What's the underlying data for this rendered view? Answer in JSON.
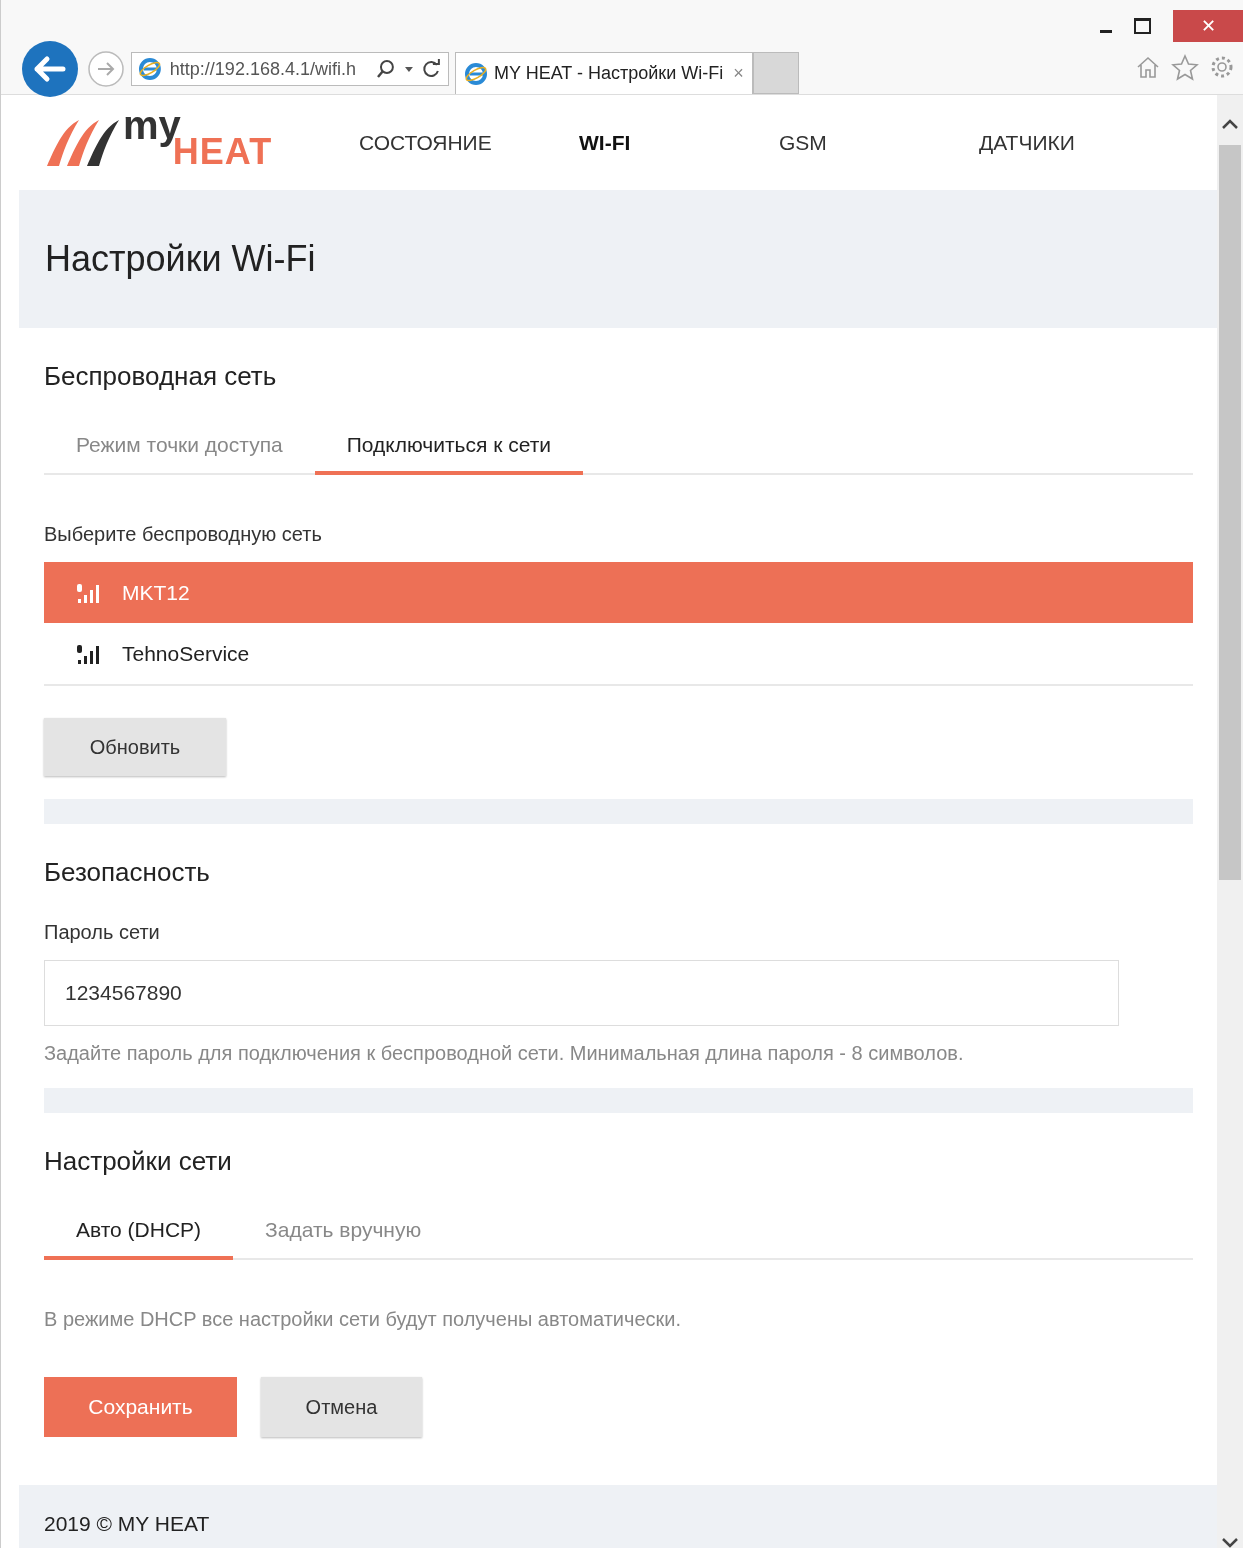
{
  "browser": {
    "address": "http://192.168.4.1/wifi.h",
    "tab_title": "MY HEAT - Настройки Wi-Fi",
    "tab_close": "×",
    "window_close": "✕"
  },
  "logo": {
    "top": "my",
    "bottom": "HEAT"
  },
  "nav": [
    {
      "label": "СОСТОЯНИЕ",
      "selected": false
    },
    {
      "label": "WI-FI",
      "selected": true
    },
    {
      "label": "GSM",
      "selected": false
    },
    {
      "label": "ДАТЧИКИ",
      "selected": false
    }
  ],
  "page_title": "Настройки Wi-Fi",
  "wireless": {
    "title": "Беспроводная сеть",
    "tabs": [
      {
        "label": "Режим точки доступа",
        "selected": false
      },
      {
        "label": "Подключиться к сети",
        "selected": true
      }
    ],
    "list_label": "Выберите беспроводную сеть",
    "networks": [
      {
        "name": "MKT12",
        "selected": true
      },
      {
        "name": "TehnoService",
        "selected": false
      }
    ],
    "refresh_button": "Обновить"
  },
  "security": {
    "title": "Безопасность",
    "field_label": "Пароль сети",
    "password": "1234567890",
    "hint": "Задайте пароль для подключения к беспроводной сети. Минимальная длина пароля - 8 символов."
  },
  "network_settings": {
    "title": "Настройки сети",
    "tabs": [
      {
        "label": "Авто (DHCP)",
        "selected": true
      },
      {
        "label": "Задать вручную",
        "selected": false
      }
    ],
    "note": "В режиме DHCP все настройки сети будут получены автоматически."
  },
  "buttons": {
    "save": "Сохранить",
    "cancel": "Отмена"
  },
  "footer": "2019 © MY HEAT"
}
